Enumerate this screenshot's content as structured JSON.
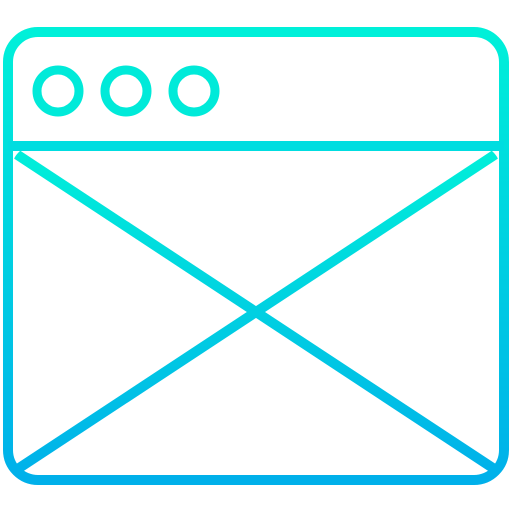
{
  "icon": {
    "name": "browser-window-placeholder-icon",
    "gradient": {
      "top_color": "#00F0D9",
      "bottom_color": "#00B0EA"
    },
    "window_controls": [
      "dot",
      "dot",
      "dot"
    ]
  }
}
